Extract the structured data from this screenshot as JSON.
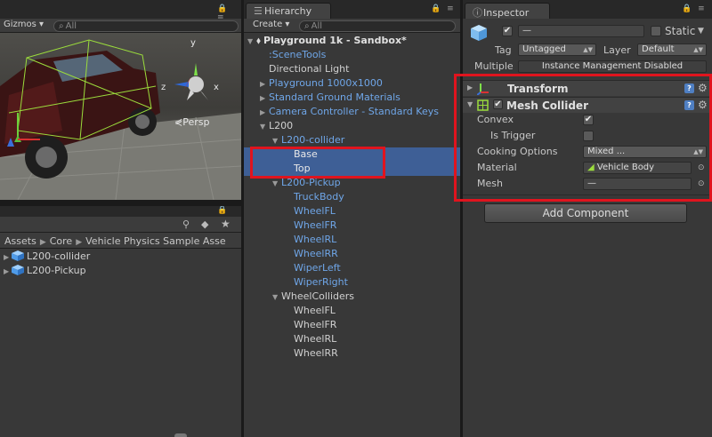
{
  "scene": {
    "gizmos_label": "Gizmos",
    "search_placeholder": "All",
    "persp_label": "Persp",
    "axis_labels": {
      "y": "y",
      "z": "z",
      "x": "x"
    }
  },
  "project": {
    "breadcrumb": [
      "Assets",
      "Core",
      "Vehicle Physics Sample Asse"
    ],
    "items": [
      {
        "label": "L200-collider"
      },
      {
        "label": "L200-Pickup"
      }
    ]
  },
  "hierarchy": {
    "tab_label": "Hierarchy",
    "create_label": "Create",
    "search_placeholder": "All",
    "scene_name": "Playground 1k - Sandbox*",
    "rows": [
      {
        "label": ":SceneTools",
        "blue": true,
        "indent": 1,
        "expander": ""
      },
      {
        "label": "Directional Light",
        "blue": false,
        "indent": 1,
        "expander": ""
      },
      {
        "label": "Playground 1000x1000",
        "blue": true,
        "indent": 1,
        "expander": "collapsed"
      },
      {
        "label": "Standard Ground Materials",
        "blue": true,
        "indent": 1,
        "expander": "collapsed"
      },
      {
        "label": "Camera Controller - Standard Keys",
        "blue": true,
        "indent": 1,
        "expander": "collapsed"
      },
      {
        "label": "L200",
        "blue": false,
        "indent": 1,
        "expander": "expanded"
      },
      {
        "label": "L200-collider",
        "blue": true,
        "indent": 2,
        "expander": "expanded"
      },
      {
        "label": "Base",
        "blue": false,
        "indent": 3,
        "expander": "",
        "selected": true
      },
      {
        "label": "Top",
        "blue": false,
        "indent": 3,
        "expander": "",
        "selected": true
      },
      {
        "label": "L200-Pickup",
        "blue": true,
        "indent": 2,
        "expander": "expanded"
      },
      {
        "label": "TruckBody",
        "blue": true,
        "indent": 3,
        "expander": ""
      },
      {
        "label": "WheelFL",
        "blue": true,
        "indent": 3,
        "expander": ""
      },
      {
        "label": "WheelFR",
        "blue": true,
        "indent": 3,
        "expander": ""
      },
      {
        "label": "WheelRL",
        "blue": true,
        "indent": 3,
        "expander": ""
      },
      {
        "label": "WheelRR",
        "blue": true,
        "indent": 3,
        "expander": ""
      },
      {
        "label": "WiperLeft",
        "blue": true,
        "indent": 3,
        "expander": ""
      },
      {
        "label": "WiperRight",
        "blue": true,
        "indent": 3,
        "expander": ""
      },
      {
        "label": "WheelColliders",
        "blue": false,
        "indent": 2,
        "expander": "expanded"
      },
      {
        "label": "WheelFL",
        "blue": false,
        "indent": 3,
        "expander": ""
      },
      {
        "label": "WheelFR",
        "blue": false,
        "indent": 3,
        "expander": ""
      },
      {
        "label": "WheelRL",
        "blue": false,
        "indent": 3,
        "expander": ""
      },
      {
        "label": "WheelRR",
        "blue": false,
        "indent": 3,
        "expander": ""
      }
    ]
  },
  "inspector": {
    "tab_label": "Inspector",
    "name_value": "—",
    "active_checked": true,
    "static_label": "Static",
    "tag_label": "Tag",
    "tag_value": "Untagged",
    "layer_label": "Layer",
    "layer_value": "Default",
    "multiple_label": "Multiple",
    "multiple_value": "Instance Management Disabled",
    "transform_title": "Transform",
    "mesh_collider_title": "Mesh Collider",
    "fields": {
      "convex_label": "Convex",
      "convex_checked": true,
      "is_trigger_label": "Is Trigger",
      "is_trigger_checked": false,
      "cooking_label": "Cooking Options",
      "cooking_value": "Mixed ...",
      "material_label": "Material",
      "material_value": "Vehicle Body",
      "mesh_label": "Mesh",
      "mesh_value": "—"
    },
    "add_component_label": "Add Component"
  },
  "colors": {
    "highlight": "#e0141e",
    "selection": "#3e5f96",
    "prefab_blue": "#6fa6e8"
  }
}
